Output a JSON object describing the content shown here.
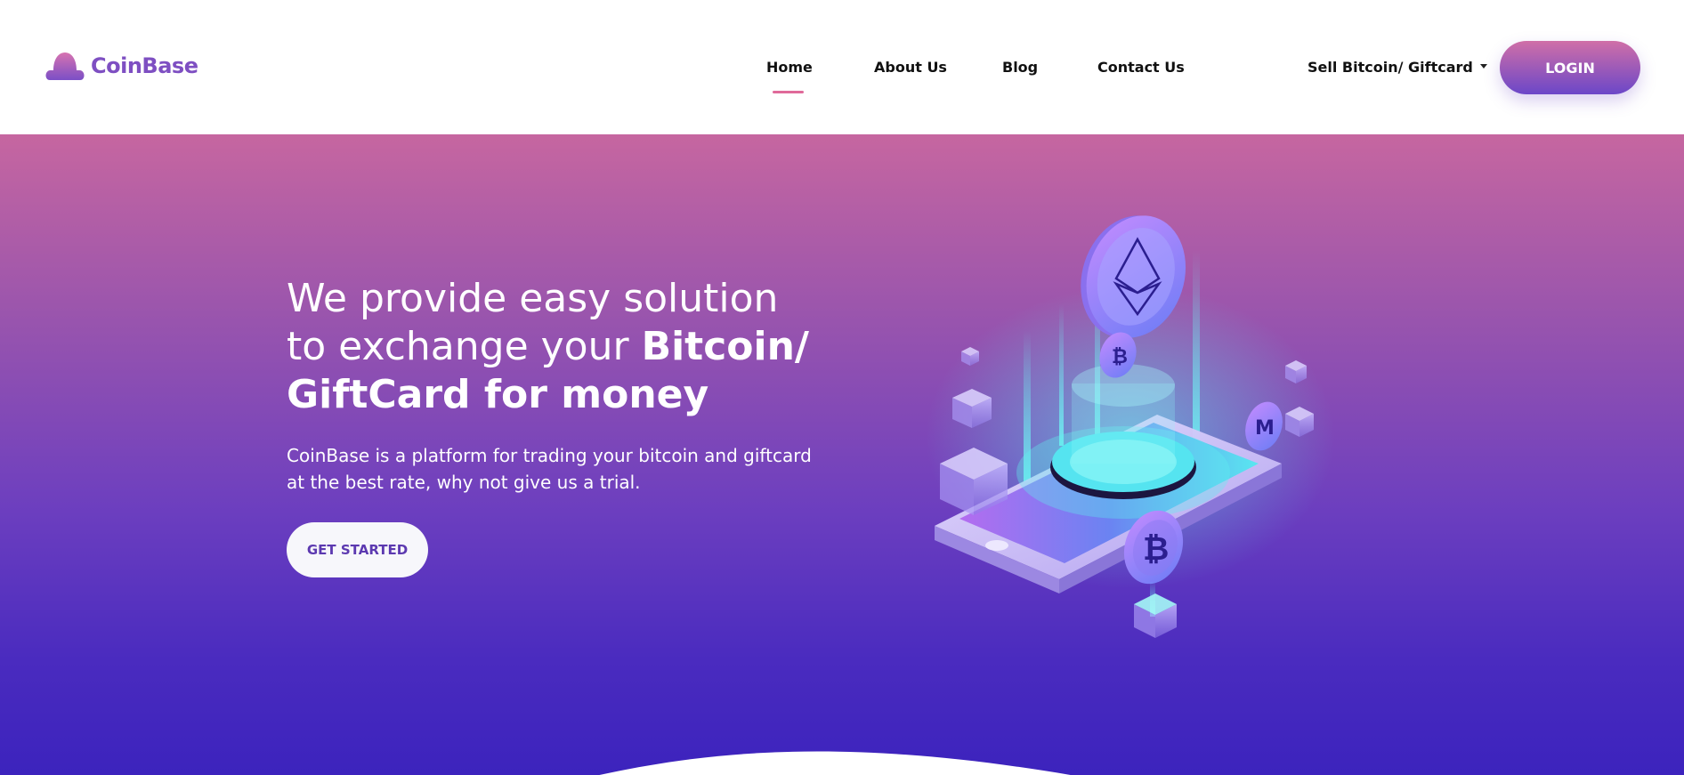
{
  "brand": {
    "name": "CoinBase"
  },
  "nav": {
    "items": [
      "Home",
      "About Us",
      "Blog",
      "Contact Us"
    ],
    "active": "Home",
    "dropdown_label": "Sell Bitcoin/ Giftcard",
    "login_label": "LOGIN"
  },
  "hero": {
    "title_line1": "We provide easy solution",
    "title_line2_regular": "to exchange your ",
    "title_line2_bold": "Bitcoin/",
    "title_line3_bold": "GiftCard for money",
    "description_line1": "CoinBase is a platform for trading your bitcoin and giftcard",
    "description_line2": "at the best rate, why not give us a trial.",
    "cta_label": "GET STARTED"
  },
  "illustration": {
    "coin_symbols": [
      "ethereum-icon",
      "bitcoin-icon",
      "monero-icon"
    ]
  },
  "colors": {
    "brand": "#7e4fc2",
    "accent_pink": "#e06a9a",
    "hero_top": "#c666a0",
    "hero_bottom": "#3c23bd"
  }
}
